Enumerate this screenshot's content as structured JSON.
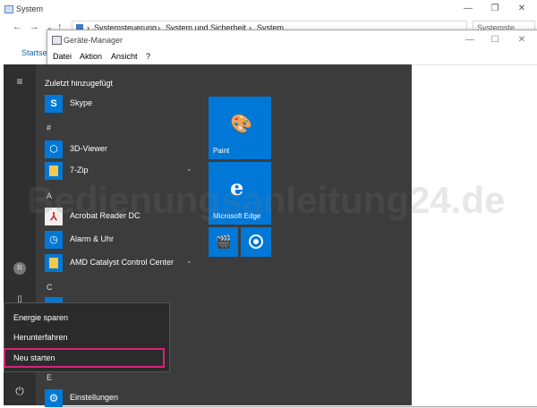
{
  "system_window": {
    "title": "System",
    "address": [
      "Systemsteuerung",
      "System und Sicherheit",
      "System"
    ],
    "search_placeholder": "Systemste",
    "left_label": "Startse"
  },
  "device_manager": {
    "title": "Geräte-Manager",
    "menu": [
      "Datei",
      "Aktion",
      "Ansicht",
      "?"
    ]
  },
  "start_menu": {
    "recent_header": "Zuletzt hinzugefügt",
    "avatar_letter": "R",
    "apps": {
      "skype": "Skype",
      "hash_letter": "#",
      "viewer3d": "3D-Viewer",
      "zip": "7-Zip",
      "a_letter": "A",
      "acrobat": "Acrobat Reader DC",
      "alarm": "Alarm & Uhr",
      "amd": "AMD Catalyst Control Center",
      "c_letter": "C",
      "e_letter": "E",
      "einstellungen": "Einstellungen"
    },
    "tiles": {
      "paint": "Paint",
      "edge": "Microsoft Edge"
    }
  },
  "power_menu": {
    "items": [
      "Energie sparen",
      "Herunterfahren",
      "Neu starten"
    ]
  },
  "watermark": "Bedienungsanleitung24.de",
  "colors": {
    "tile_blue": "#0078d7",
    "start_bg": "#3c3c3c",
    "highlight": "#d8237a"
  }
}
